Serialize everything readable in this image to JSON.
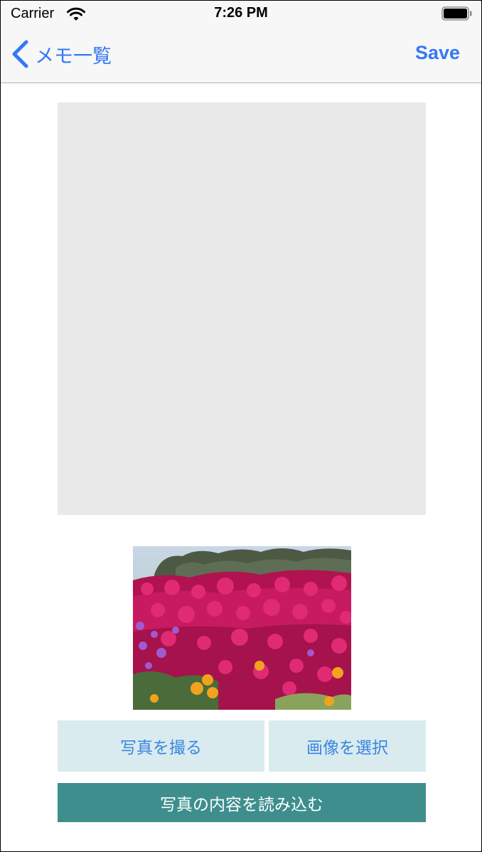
{
  "status_bar": {
    "carrier": "Carrier",
    "time": "7:26 PM",
    "icons": [
      "wifi-icon",
      "battery-icon"
    ]
  },
  "nav": {
    "back_label": "メモ一覧",
    "back_icon": "chevron-left-icon",
    "save_label": "Save",
    "accent_color": "#3478f6"
  },
  "content": {
    "memo_text": "",
    "photo": "flower-field-image"
  },
  "buttons": {
    "take_photo": "写真を撮る",
    "select_image": "画像を選択",
    "read_photo": "写真の内容を読み込む",
    "light_button_color": "#d9ebef",
    "primary_button_color": "#3e8e8e"
  }
}
